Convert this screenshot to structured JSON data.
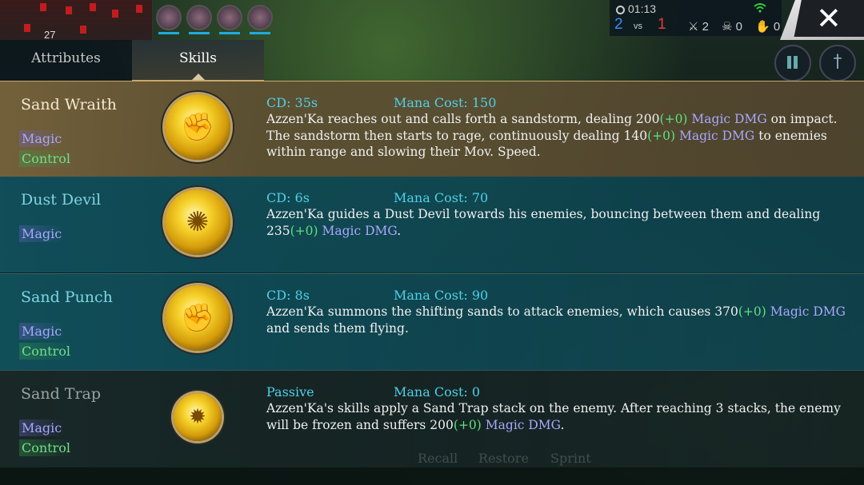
{
  "hud": {
    "level": "27",
    "timer": "01:13",
    "team_blue_score": "2",
    "vs_label": "vs",
    "team_red_score": "1",
    "kills": "2",
    "deaths": "0",
    "assists": "0",
    "close_label": "✕",
    "sword_icon": "†"
  },
  "tabs": [
    {
      "label": "Attributes",
      "active": false
    },
    {
      "label": "Skills",
      "active": true
    }
  ],
  "skills": [
    {
      "name": "Sand Wraith",
      "tags": [
        "Magic",
        "Control"
      ],
      "cd": "CD: 35s",
      "mana": "Mana Cost: 150",
      "desc_parts": [
        "Azzen'Ka reaches out and calls forth a sandstorm, dealing 200",
        "(+0)",
        " ",
        "Magic DMG",
        " on impact. The sandstorm then starts to rage, continuously dealing 140",
        "(+0)",
        " ",
        "Magic DMG",
        " to enemies within range and slowing their Mov. Speed."
      ],
      "icon": "fist-icon"
    },
    {
      "name": "Dust Devil",
      "tags": [
        "Magic"
      ],
      "cd": "CD: 6s",
      "mana": "Mana Cost: 70",
      "desc_parts": [
        "Azzen'Ka guides a Dust Devil towards his enemies, bouncing between them and dealing 235",
        "(+0)",
        " ",
        "Magic DMG",
        "."
      ],
      "icon": "whirlwind-icon"
    },
    {
      "name": "Sand Punch",
      "tags": [
        "Magic",
        "Control"
      ],
      "cd": "CD: 8s",
      "mana": "Mana Cost: 90",
      "desc_parts": [
        "Azzen'Ka summons the shifting sands to attack enemies, which causes 370",
        "(+0)",
        " ",
        "Magic DMG",
        " and sends them flying."
      ],
      "icon": "punch-icon"
    },
    {
      "name": "Sand Trap",
      "tags": [
        "Magic",
        "Control"
      ],
      "cd": "Passive",
      "mana": "Mana Cost: 0",
      "desc_parts": [
        "Azzen'Ka's skills apply a Sand Trap stack on the enemy. After reaching 3 stacks, the enemy will be frozen and suffers 200",
        "(+0)",
        " ",
        "Magic DMG",
        "."
      ],
      "icon": "sand-vortex-icon"
    }
  ],
  "background_labels": [
    "Recall",
    "Restore",
    "Sprint"
  ]
}
